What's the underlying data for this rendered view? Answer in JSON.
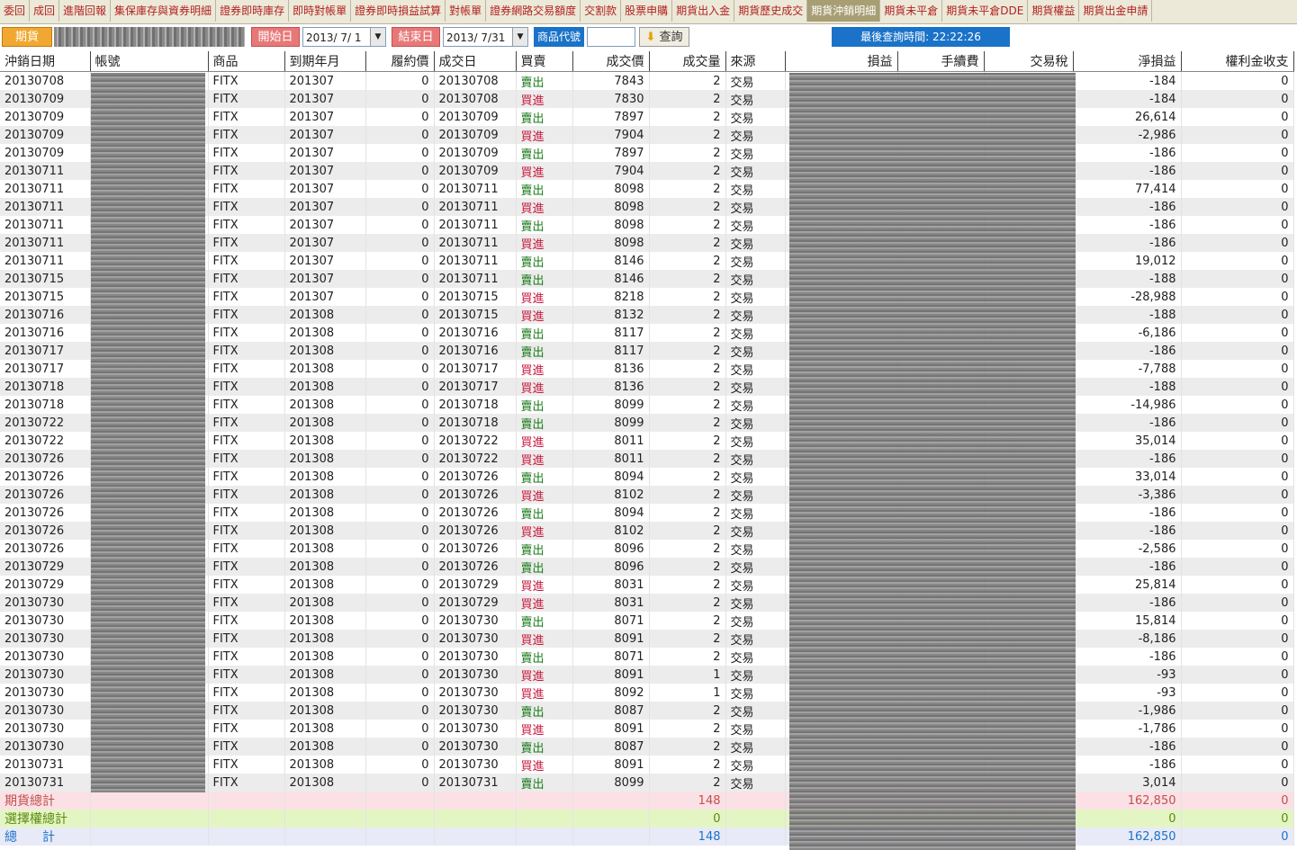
{
  "tabs": [
    "委回",
    "成回",
    "進階回報",
    "集保庫存與資券明細",
    "證券即時庫存",
    "即時對帳單",
    "證券即時損益試算",
    "對帳單",
    "證券網路交易額度",
    "交割款",
    "股票申購",
    "期貨出入金",
    "期貨歷史成交",
    "期貨沖銷明細",
    "期貨未平倉",
    "期貨未平倉DDE",
    "期貨權益",
    "期貨出金申請"
  ],
  "active_tab": "期貨沖銷明細",
  "toolbar": {
    "market": "期貨",
    "start_label": "開始日",
    "start_date": "2013/ 7/ 1",
    "end_label": "結束日",
    "end_date": "2013/ 7/31",
    "product_label": "商品代號",
    "product_value": "",
    "query_label": "查詢",
    "last_query": "最後查詢時間: 22:22:26"
  },
  "columns": [
    "沖銷日期",
    "帳號",
    "商品",
    "到期年月",
    "履約價",
    "成交日",
    "買賣",
    "成交價",
    "成交量",
    "來源",
    "損益",
    "手續費",
    "交易稅",
    "淨損益",
    "權利金收支"
  ],
  "rows": [
    [
      "20130708",
      "FITX",
      "201307",
      "0",
      "20130708",
      "賣出",
      "7843",
      "2",
      "交易",
      "-184",
      "0"
    ],
    [
      "20130709",
      "FITX",
      "201307",
      "0",
      "20130708",
      "買進",
      "7830",
      "2",
      "交易",
      "-184",
      "0"
    ],
    [
      "20130709",
      "FITX",
      "201307",
      "0",
      "20130709",
      "賣出",
      "7897",
      "2",
      "交易",
      "26,614",
      "0"
    ],
    [
      "20130709",
      "FITX",
      "201307",
      "0",
      "20130709",
      "買進",
      "7904",
      "2",
      "交易",
      "-2,986",
      "0"
    ],
    [
      "20130709",
      "FITX",
      "201307",
      "0",
      "20130709",
      "賣出",
      "7897",
      "2",
      "交易",
      "-186",
      "0"
    ],
    [
      "20130711",
      "FITX",
      "201307",
      "0",
      "20130709",
      "買進",
      "7904",
      "2",
      "交易",
      "-186",
      "0"
    ],
    [
      "20130711",
      "FITX",
      "201307",
      "0",
      "20130711",
      "賣出",
      "8098",
      "2",
      "交易",
      "77,414",
      "0"
    ],
    [
      "20130711",
      "FITX",
      "201307",
      "0",
      "20130711",
      "買進",
      "8098",
      "2",
      "交易",
      "-186",
      "0"
    ],
    [
      "20130711",
      "FITX",
      "201307",
      "0",
      "20130711",
      "賣出",
      "8098",
      "2",
      "交易",
      "-186",
      "0"
    ],
    [
      "20130711",
      "FITX",
      "201307",
      "0",
      "20130711",
      "買進",
      "8098",
      "2",
      "交易",
      "-186",
      "0"
    ],
    [
      "20130711",
      "FITX",
      "201307",
      "0",
      "20130711",
      "賣出",
      "8146",
      "2",
      "交易",
      "19,012",
      "0"
    ],
    [
      "20130715",
      "FITX",
      "201307",
      "0",
      "20130711",
      "賣出",
      "8146",
      "2",
      "交易",
      "-188",
      "0"
    ],
    [
      "20130715",
      "FITX",
      "201307",
      "0",
      "20130715",
      "買進",
      "8218",
      "2",
      "交易",
      "-28,988",
      "0"
    ],
    [
      "20130716",
      "FITX",
      "201308",
      "0",
      "20130715",
      "買進",
      "8132",
      "2",
      "交易",
      "-188",
      "0"
    ],
    [
      "20130716",
      "FITX",
      "201308",
      "0",
      "20130716",
      "賣出",
      "8117",
      "2",
      "交易",
      "-6,186",
      "0"
    ],
    [
      "20130717",
      "FITX",
      "201308",
      "0",
      "20130716",
      "賣出",
      "8117",
      "2",
      "交易",
      "-186",
      "0"
    ],
    [
      "20130717",
      "FITX",
      "201308",
      "0",
      "20130717",
      "買進",
      "8136",
      "2",
      "交易",
      "-7,788",
      "0"
    ],
    [
      "20130718",
      "FITX",
      "201308",
      "0",
      "20130717",
      "買進",
      "8136",
      "2",
      "交易",
      "-188",
      "0"
    ],
    [
      "20130718",
      "FITX",
      "201308",
      "0",
      "20130718",
      "賣出",
      "8099",
      "2",
      "交易",
      "-14,986",
      "0"
    ],
    [
      "20130722",
      "FITX",
      "201308",
      "0",
      "20130718",
      "賣出",
      "8099",
      "2",
      "交易",
      "-186",
      "0"
    ],
    [
      "20130722",
      "FITX",
      "201308",
      "0",
      "20130722",
      "買進",
      "8011",
      "2",
      "交易",
      "35,014",
      "0"
    ],
    [
      "20130726",
      "FITX",
      "201308",
      "0",
      "20130722",
      "買進",
      "8011",
      "2",
      "交易",
      "-186",
      "0"
    ],
    [
      "20130726",
      "FITX",
      "201308",
      "0",
      "20130726",
      "賣出",
      "8094",
      "2",
      "交易",
      "33,014",
      "0"
    ],
    [
      "20130726",
      "FITX",
      "201308",
      "0",
      "20130726",
      "買進",
      "8102",
      "2",
      "交易",
      "-3,386",
      "0"
    ],
    [
      "20130726",
      "FITX",
      "201308",
      "0",
      "20130726",
      "賣出",
      "8094",
      "2",
      "交易",
      "-186",
      "0"
    ],
    [
      "20130726",
      "FITX",
      "201308",
      "0",
      "20130726",
      "買進",
      "8102",
      "2",
      "交易",
      "-186",
      "0"
    ],
    [
      "20130726",
      "FITX",
      "201308",
      "0",
      "20130726",
      "賣出",
      "8096",
      "2",
      "交易",
      "-2,586",
      "0"
    ],
    [
      "20130729",
      "FITX",
      "201308",
      "0",
      "20130726",
      "賣出",
      "8096",
      "2",
      "交易",
      "-186",
      "0"
    ],
    [
      "20130729",
      "FITX",
      "201308",
      "0",
      "20130729",
      "買進",
      "8031",
      "2",
      "交易",
      "25,814",
      "0"
    ],
    [
      "20130730",
      "FITX",
      "201308",
      "0",
      "20130729",
      "買進",
      "8031",
      "2",
      "交易",
      "-186",
      "0"
    ],
    [
      "20130730",
      "FITX",
      "201308",
      "0",
      "20130730",
      "賣出",
      "8071",
      "2",
      "交易",
      "15,814",
      "0"
    ],
    [
      "20130730",
      "FITX",
      "201308",
      "0",
      "20130730",
      "買進",
      "8091",
      "2",
      "交易",
      "-8,186",
      "0"
    ],
    [
      "20130730",
      "FITX",
      "201308",
      "0",
      "20130730",
      "賣出",
      "8071",
      "2",
      "交易",
      "-186",
      "0"
    ],
    [
      "20130730",
      "FITX",
      "201308",
      "0",
      "20130730",
      "買進",
      "8091",
      "1",
      "交易",
      "-93",
      "0"
    ],
    [
      "20130730",
      "FITX",
      "201308",
      "0",
      "20130730",
      "買進",
      "8092",
      "1",
      "交易",
      "-93",
      "0"
    ],
    [
      "20130730",
      "FITX",
      "201308",
      "0",
      "20130730",
      "賣出",
      "8087",
      "2",
      "交易",
      "-1,986",
      "0"
    ],
    [
      "20130730",
      "FITX",
      "201308",
      "0",
      "20130730",
      "買進",
      "8091",
      "2",
      "交易",
      "-1,786",
      "0"
    ],
    [
      "20130730",
      "FITX",
      "201308",
      "0",
      "20130730",
      "賣出",
      "8087",
      "2",
      "交易",
      "-186",
      "0"
    ],
    [
      "20130731",
      "FITX",
      "201308",
      "0",
      "20130730",
      "買進",
      "8091",
      "2",
      "交易",
      "-186",
      "0"
    ],
    [
      "20130731",
      "FITX",
      "201308",
      "0",
      "20130731",
      "賣出",
      "8099",
      "2",
      "交易",
      "3,014",
      "0"
    ]
  ],
  "summary": [
    {
      "label": "期貨總計",
      "qty": "148",
      "net": "162,850",
      "premium": "0"
    },
    {
      "label": "選擇權總計",
      "qty": "0",
      "net": "0",
      "premium": "0"
    },
    {
      "label": "總　　計",
      "qty": "148",
      "net": "162,850",
      "premium": "0"
    }
  ]
}
